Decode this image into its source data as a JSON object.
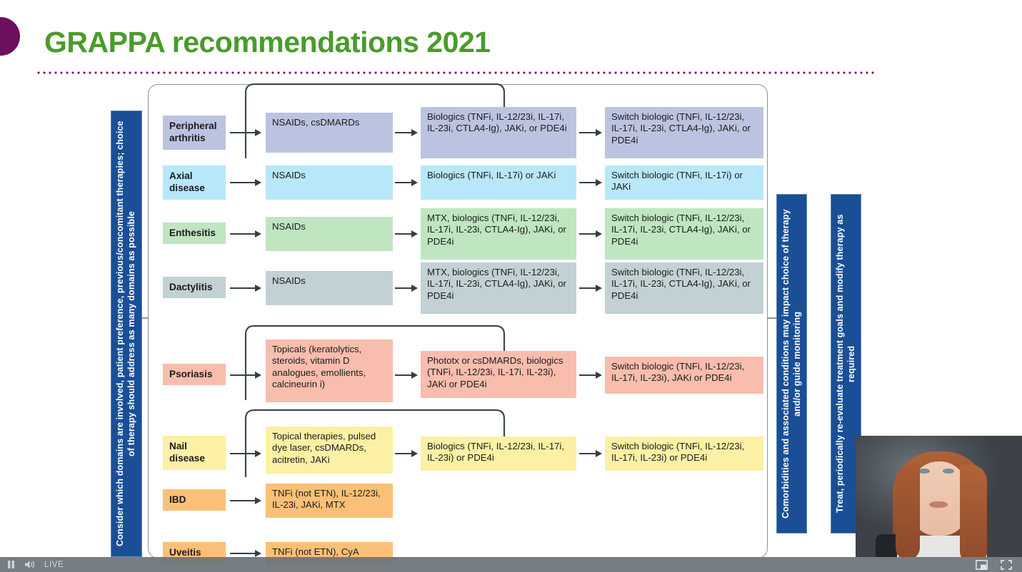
{
  "slide": {
    "title": "GRAPPA recommendations 2021"
  },
  "figure": {
    "left_bar": "Consider which domains are involved, patient preference, previous/concomitant therapies; choice of therapy should address as many domains as possible",
    "comorbidity_bar": "Comorbidities and associated conditions may impact choice of therapy and/or guide monitoring",
    "reevaluate_bar": "Treat, periodically re-evaluate treatment goals and modify therapy as required",
    "rows": [
      {
        "id": "peripheral-arthritis",
        "label": "Peripheral arthritis",
        "first_line": "NSAIDs, csDMARDs",
        "second_line": "Biologics (TNFi, IL-12/23i, IL-17i, IL-23i, CTLA4-Ig), JAKi, or PDE4i",
        "third_line": "Switch biologic (TNFi, IL-12/23i, IL-17i, IL-23i, CTLA4-Ig), JAKi, or PDE4i",
        "color": "#bcc3e0",
        "has_bypass": true
      },
      {
        "id": "axial-disease",
        "label": "Axial disease",
        "first_line": "NSAIDs",
        "second_line": "Biologics (TNFi, IL-17i) or JAKi",
        "third_line": "Switch biologic (TNFi, IL-17i) or JAKi",
        "color": "#b9e7fa",
        "has_bypass": false
      },
      {
        "id": "enthesitis",
        "label": "Enthesitis",
        "first_line": "NSAIDs",
        "second_line": "MTX, biologics (TNFi, IL-12/23i, IL-17i, IL-23i, CTLA4-Ig), JAKi, or PDE4i",
        "third_line": "Switch biologic (TNFi, IL-12/23i, IL-17i, IL-23i, CTLA4-Ig), JAKi, or PDE4i",
        "color": "#bfe6c0",
        "has_bypass": false
      },
      {
        "id": "dactylitis",
        "label": "Dactylitis",
        "first_line": "NSAIDs",
        "second_line": "MTX, biologics (TNFi, IL-12/23i, IL-17i, IL-23i, CTLA4-Ig), JAKi, or PDE4i",
        "third_line": "Switch biologic (TNFi, IL-12/23i, IL-17i, IL-23i, CTLA4-Ig), JAKi, or PDE4i",
        "color": "#c2d1d3",
        "has_bypass": false
      },
      {
        "id": "psoriasis",
        "label": "Psoriasis",
        "first_line": "Topicals (keratolytics, steroids, vitamin D analogues, emollients, calcineurin i)",
        "second_line": "Phototx or csDMARDs, biologics (TNFi, IL-12/23i, IL-17i, IL-23i), JAKi or PDE4i",
        "third_line": "Switch biologic (TNFi, IL-12/23i, IL-17i, IL-23i), JAKi or PDE4i",
        "color": "#f9bdad",
        "has_bypass": true
      },
      {
        "id": "nail-disease",
        "label": "Nail disease",
        "first_line": "Topical therapies, pulsed dye laser, csDMARDs, acitretin, JAKi",
        "second_line": "Biologics (TNFi, IL-12/23i, IL-17i, IL-23i) or PDE4i",
        "third_line": "Switch biologic (TNFi, IL-12/23i, IL-17i, IL-23i) or PDE4i",
        "color": "#fcf0a4",
        "has_bypass": true
      },
      {
        "id": "ibd",
        "label": "IBD",
        "first_line": "TNFi (not ETN), IL-12/23i, IL-23i, JAKi, MTX",
        "second_line": "",
        "third_line": "",
        "color": "#fbc077",
        "has_bypass": false
      },
      {
        "id": "uveitis",
        "label": "Uveitis",
        "first_line": "TNFi (not ETN), CyA",
        "second_line": "",
        "third_line": "",
        "color": "#fbc077",
        "has_bypass": false
      }
    ]
  },
  "player": {
    "pause_icon": "pause-icon",
    "volume_icon": "volume-icon",
    "live_label": "LIVE",
    "miniplayer_icon": "miniplayer-icon",
    "fullscreen_icon": "fullscreen-icon"
  },
  "colors": {
    "title_green": "#4a9b2b",
    "accent_purple": "#6b0f5e",
    "bar_blue": "#1a4f96"
  }
}
